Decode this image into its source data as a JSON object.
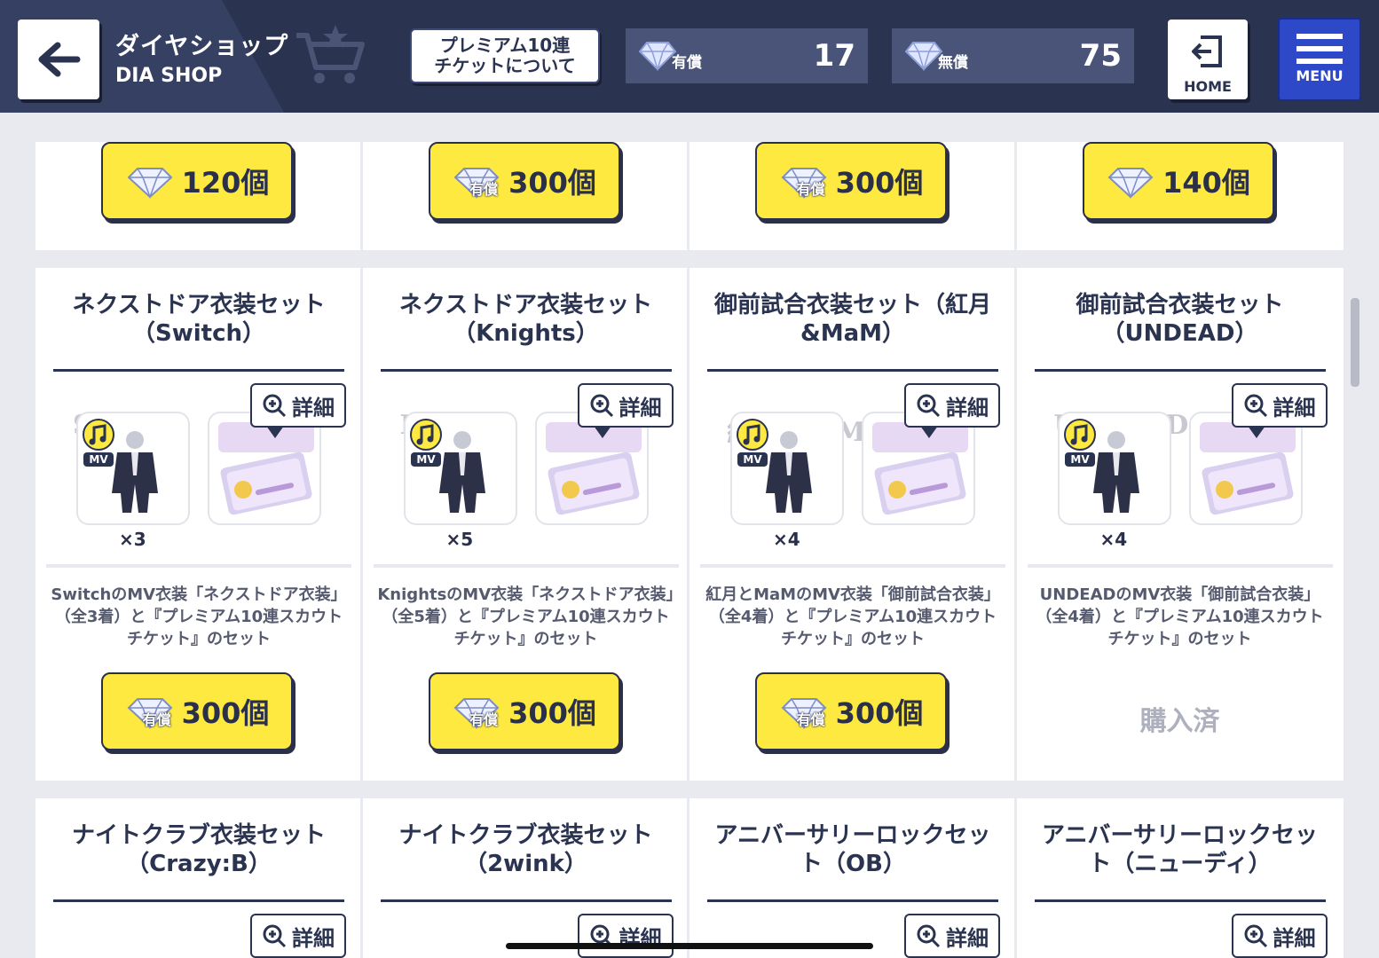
{
  "header": {
    "back_label": "←",
    "title": "ダイヤショップ",
    "subtitle": "DIA SHOP",
    "ticket_button_line1": "プレミアム10連",
    "ticket_button_line2": "チケットについて",
    "paid_label": "有償",
    "paid_value": "17",
    "free_label": "無償",
    "free_value": "75",
    "home_label": "HOME",
    "menu_label": "MENU"
  },
  "row1": [
    {
      "price": "120個",
      "paid": false
    },
    {
      "price": "300個",
      "paid": true
    },
    {
      "price": "300個",
      "paid": true
    },
    {
      "price": "140個",
      "paid": false
    }
  ],
  "row2": [
    {
      "title": "ネクストドア衣装セット（Switch）",
      "logo": "Switch",
      "qty": "×3",
      "detail": "詳細",
      "desc": "SwitchのMV衣装「ネクストドア衣装」（全3着）と『プレミアム10連スカウトチケット』のセット",
      "price": "300個",
      "paid_badge": "有償",
      "purchased": ""
    },
    {
      "title": "ネクストドア衣装セット（Knights）",
      "logo": "Knights",
      "qty": "×5",
      "detail": "詳細",
      "desc": "KnightsのMV衣装「ネクストドア衣装」（全5着）と『プレミアム10連スカウトチケット』のセット",
      "price": "300個",
      "paid_badge": "有償",
      "purchased": ""
    },
    {
      "title": "御前試合衣装セット（紅月&MaM）",
      "logo": "紅月 MaM",
      "qty": "×4",
      "detail": "詳細",
      "desc": "紅月とMaMのMV衣装「御前試合衣装」（全4着）と『プレミアム10連スカウトチケット』のセット",
      "price": "300個",
      "paid_badge": "有償",
      "purchased": ""
    },
    {
      "title": "御前試合衣装セット（UNDEAD）",
      "logo": "UNDEAD",
      "qty": "×4",
      "detail": "詳細",
      "desc": "UNDEADのMV衣装「御前試合衣装」（全4着）と『プレミアム10連スカウトチケット』のセット",
      "price": "",
      "paid_badge": "",
      "purchased": "購入済"
    }
  ],
  "row3": [
    {
      "title": "ナイトクラブ衣装セット（Crazy:B）",
      "detail": "詳細"
    },
    {
      "title": "ナイトクラブ衣装セット（2wink）",
      "detail": "詳細"
    },
    {
      "title": "アニバーサリーロックセット（OB）",
      "detail": "詳細"
    },
    {
      "title": "アニバーサリーロックセット（ニューディ）",
      "detail": "詳細"
    }
  ],
  "icons": {
    "back": "arrow-left-icon",
    "cart": "cart-icon",
    "gem": "diamond-icon",
    "home": "exit-icon",
    "menu": "hamburger-icon",
    "detail": "zoom-in-icon",
    "mv": "music-note-icon"
  },
  "colors": {
    "header_bg": "#2a3350",
    "price_button": "#fde93f",
    "menu_button": "#2d49c8",
    "page_bg": "#e9eaf0"
  }
}
